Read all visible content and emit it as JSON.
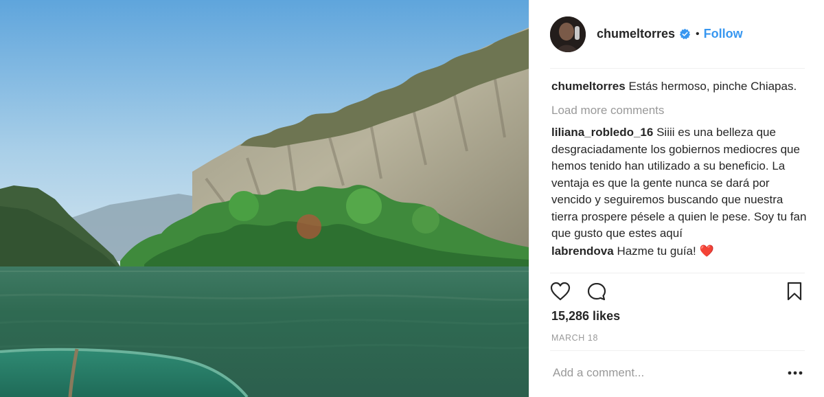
{
  "post": {
    "username": "chumeltorres",
    "separator": "•",
    "follow_label": "Follow",
    "caption": {
      "user": "chumeltorres",
      "text": "Estás hermoso, pinche Chiapas."
    },
    "load_more_label": "Load more comments",
    "comments": [
      {
        "user": "liliana_robledo_16",
        "text": "Siiii es una belleza que desgraciadamente los gobiernos mediocres que hemos tenido han utilizado a su beneficio. La ventaja es que la gente nunca se dará por vencido y seguiremos buscando que nuestra tierra prospere pésele a quien le pese. Soy tu fan que gusto que estes aquí"
      },
      {
        "user": "labrendova",
        "text": "Hazme tu guía! ❤️"
      }
    ],
    "likes": "15,286 likes",
    "date": "MARCH 18",
    "add_comment_placeholder": "Add a comment..."
  },
  "icons": {
    "verified": "verified-badge-icon",
    "like": "heart-icon",
    "comment": "comment-bubble-icon",
    "save": "bookmark-icon",
    "options": "ellipsis-icon"
  },
  "colors": {
    "accent": "#3897f0",
    "text": "#262626",
    "muted": "#999999",
    "divider": "#efefef"
  }
}
